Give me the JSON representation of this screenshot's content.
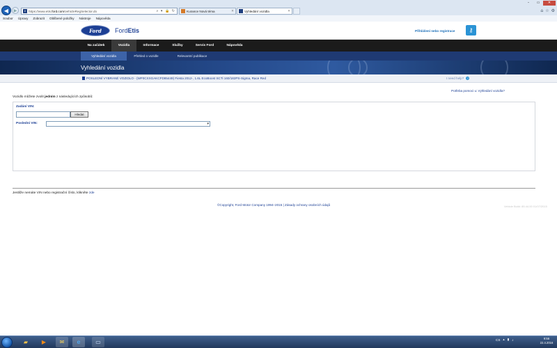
{
  "browser": {
    "url_prefix": "https://www.etis.",
    "url_host": "ford.com",
    "url_path": "/vehicleRegSelector.do",
    "address_tools": "⌕ ▾ 🔒 ↻",
    "tabs": [
      {
        "label": "Kurance Nová téma",
        "active": false
      },
      {
        "label": "Vyhledání vozidla",
        "active": true
      }
    ],
    "menu": [
      "Soubor",
      "Úpravy",
      "Zobrazit",
      "Oblíbené položky",
      "Nástroje",
      "Nápověda"
    ]
  },
  "header": {
    "logo_text": "Ford",
    "brand_prefix": "Ford",
    "brand_suffix": "Etis",
    "login_link": "Přihlášení nebo registrace"
  },
  "main_nav": [
    "Na začátek",
    "Vozidla",
    "Informace",
    "Služby",
    "Servis Ford",
    "Nápověda"
  ],
  "main_nav_active": "Vozidla",
  "sub_nav": [
    "Vyhledání vozidla",
    "Přehled o vozidle",
    "Relevantní publikace"
  ],
  "sub_nav_active": "Vyhledání vozidla",
  "banner_title": "Vyhledání vozidla",
  "vehicle_bar": {
    "text": "POSLEDNÍ VYBRANÉ VOZIDLO - (WF0CXXGAKCFD85449) Fiesta 2012-, 1.6L EcoBoost SCTi 160/182PS-Sigma, Race Red",
    "need_help": "I need help?"
  },
  "content": {
    "help_link": "Potřeba pomoci u: Vyhledání vozidla?",
    "intro_pre": "Vozidlo můžete zvolit ",
    "intro_bold": "jedním",
    "intro_post": " z následujících způsobů:",
    "vin_label": "Zadání VIN:",
    "vin_value": "",
    "search_button": "Hledat",
    "last_vin_label": "Poslední VIN:",
    "last_vin_value": ""
  },
  "footer": {
    "no_vin_text": "Jestliže nemáte VIN nebo registrační číslo, klikněte ",
    "no_vin_link": "zde",
    "copyright": "©Copyright, Ford Motor Company 1994–2015 | Zásady ochrany osobních údajů",
    "faint_text": "Vehicle Build: 85.44.00 01/07/2015"
  },
  "taskbar": {
    "tray_lang": "CS",
    "clock_time": "9:56",
    "clock_date": "22.4.2016"
  },
  "colors": {
    "ford_blue": "#1c3f94",
    "nav_black": "#1b1b1b",
    "subnav_blue": "#1f3a73",
    "accent_blue": "#2a93d5"
  }
}
